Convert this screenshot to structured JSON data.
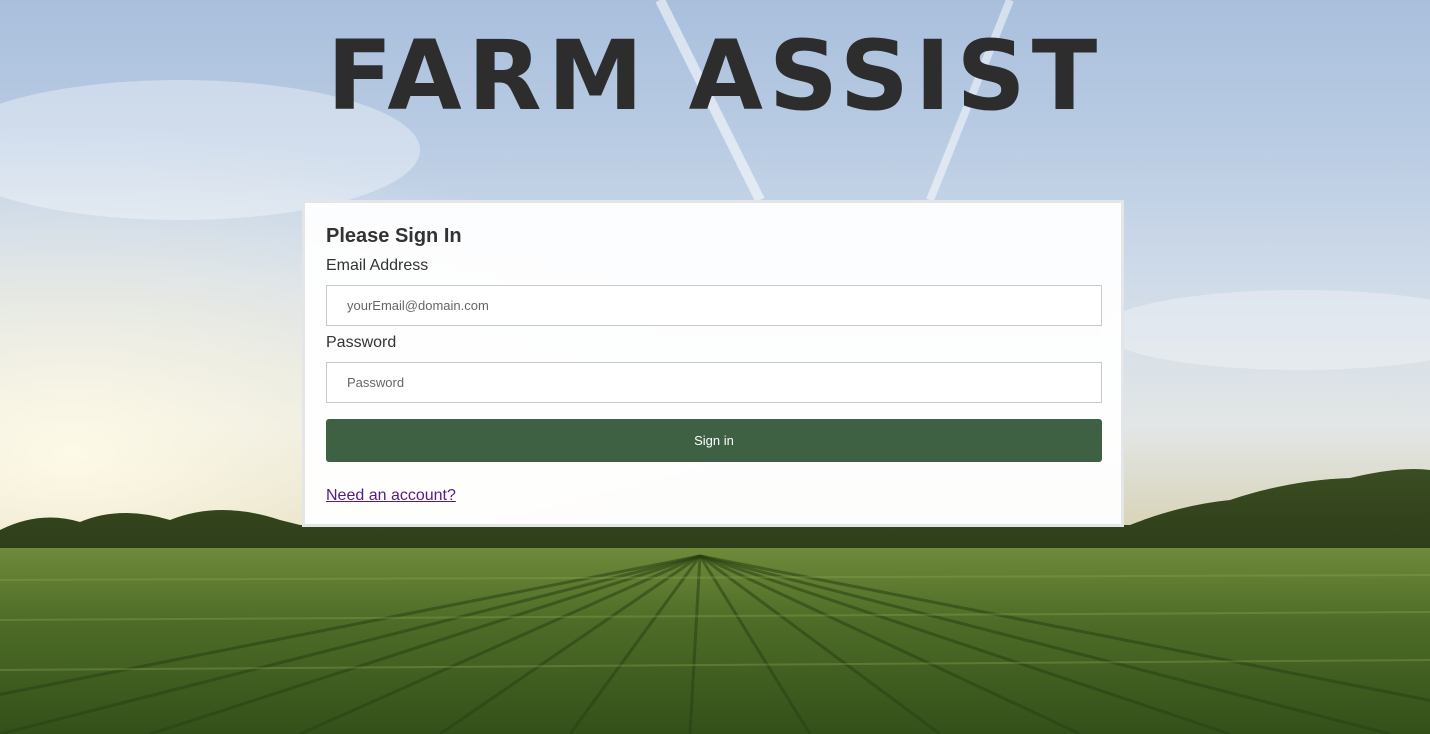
{
  "brand": {
    "title": "FARM ASSIST"
  },
  "signin": {
    "heading": "Please Sign In",
    "email_label": "Email Address",
    "email_placeholder": "yourEmail@domain.com",
    "password_label": "Password",
    "password_placeholder": "Password",
    "submit_label": "Sign in",
    "register_link": "Need an account?"
  },
  "colors": {
    "button": "#3d6142",
    "title": "#2e2d2e",
    "link": "#551a8b"
  }
}
